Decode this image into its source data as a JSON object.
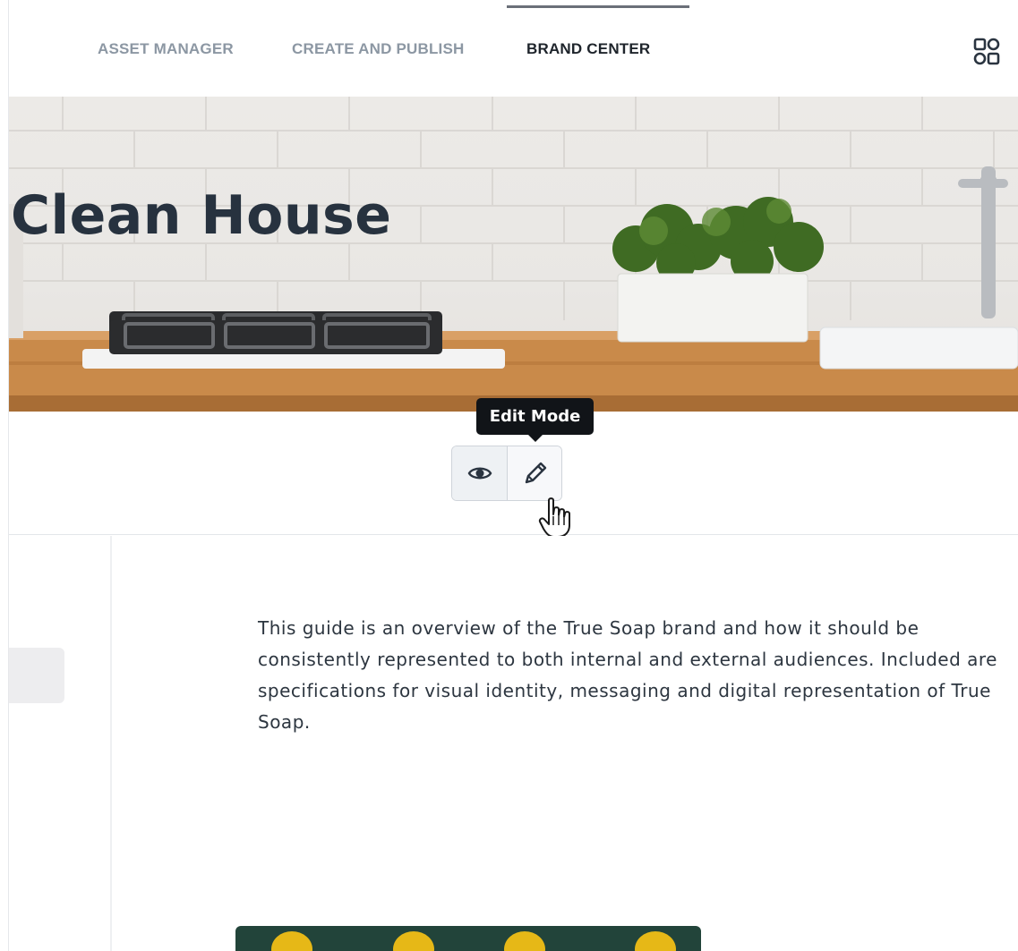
{
  "nav": {
    "tabs": [
      {
        "label": "ASSET MANAGER",
        "active": false
      },
      {
        "label": "CREATE AND PUBLISH",
        "active": false
      },
      {
        "label": "BRAND CENTER",
        "active": true
      }
    ],
    "apps_icon": "apps-grid-icon"
  },
  "hero": {
    "title": "Clean House"
  },
  "mode_toggle": {
    "tooltip": "Edit Mode",
    "view_icon": "eye-icon",
    "edit_icon": "pencil-icon",
    "selected": "edit"
  },
  "content": {
    "intro": "This guide is an overview of the True Soap brand and how it should be consistently represented to both internal and external audiences. Included are specifications for visual identity, messaging and digital representation of True Soap."
  },
  "colors": {
    "title": "#27323f",
    "nav_inactive": "#8c97a3",
    "nav_active": "#1e242b",
    "tooltip_bg": "#111418",
    "counter_wood": "#c98a4a",
    "preview_bg": "#22443a",
    "lemon": "#e6b817"
  }
}
